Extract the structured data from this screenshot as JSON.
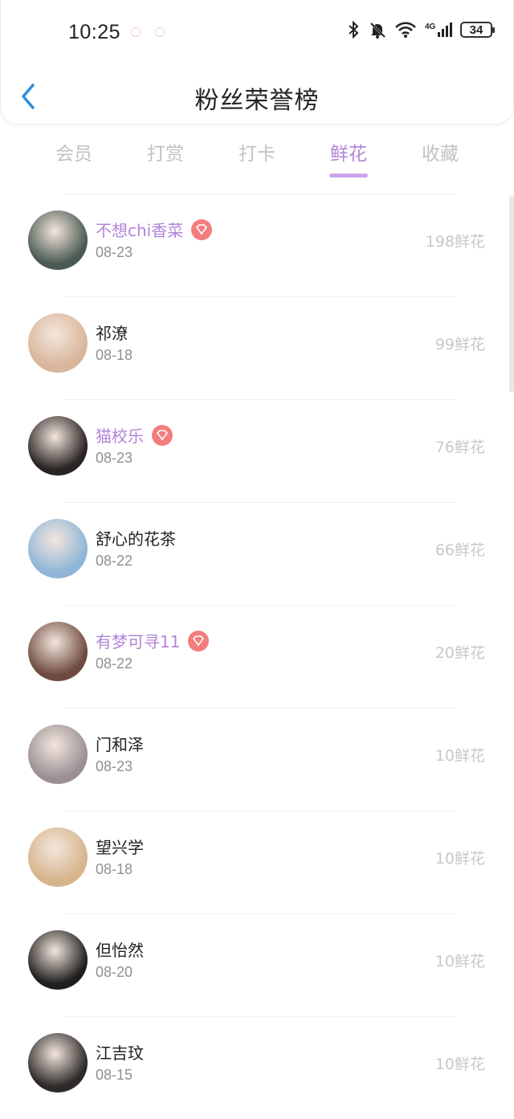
{
  "status_bar": {
    "time": "10:25",
    "battery": "34",
    "icons": [
      "bluetooth-icon",
      "bell-muted-icon",
      "wifi-icon",
      "4g-signal-icon",
      "battery-icon"
    ]
  },
  "header": {
    "title": "粉丝荣誉榜"
  },
  "tabs": [
    {
      "label": "会员",
      "active": false
    },
    {
      "label": "打赏",
      "active": false
    },
    {
      "label": "打卡",
      "active": false
    },
    {
      "label": "鲜花",
      "active": true
    },
    {
      "label": "收藏",
      "active": false
    }
  ],
  "list": [
    {
      "name": "不想chi香菜",
      "date": "08-23",
      "count": "198鲜花",
      "vip": true,
      "avatar_color": "#4a5a52"
    },
    {
      "name": "祁潦",
      "date": "08-18",
      "count": "99鲜花",
      "vip": false,
      "avatar_color": "#d9b59a"
    },
    {
      "name": "猫校乐",
      "date": "08-23",
      "count": "76鲜花",
      "vip": true,
      "avatar_color": "#2a2424"
    },
    {
      "name": "舒心的花茶",
      "date": "08-22",
      "count": "66鲜花",
      "vip": false,
      "avatar_color": "#8fb6d8"
    },
    {
      "name": "有梦可寻11",
      "date": "08-22",
      "count": "20鲜花",
      "vip": true,
      "avatar_color": "#6e4a40"
    },
    {
      "name": "门和泽",
      "date": "08-23",
      "count": "10鲜花",
      "vip": false,
      "avatar_color": "#9a8f94"
    },
    {
      "name": "望兴学",
      "date": "08-18",
      "count": "10鲜花",
      "vip": false,
      "avatar_color": "#d6b48c"
    },
    {
      "name": "但怡然",
      "date": "08-20",
      "count": "10鲜花",
      "vip": false,
      "avatar_color": "#1f1f1f"
    },
    {
      "name": "江吉玟",
      "date": "08-15",
      "count": "10鲜花",
      "vip": false,
      "avatar_color": "#2e2a2a"
    }
  ],
  "colors": {
    "accent": "#b184d9",
    "badge": "#f37d7d",
    "back_arrow": "#2d8fe0"
  }
}
